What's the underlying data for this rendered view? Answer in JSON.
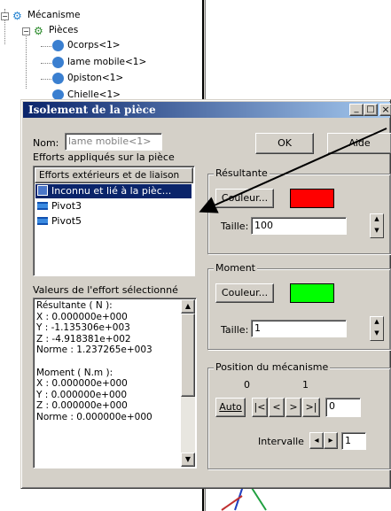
{
  "tree": {
    "root_label": "Mécanisme",
    "parts_label": "Pièces",
    "items": [
      "0corps<1>",
      "lame mobile<1>",
      "0piston<1>",
      "Chielle<1>"
    ]
  },
  "dialog": {
    "title": "Isolement de la pièce",
    "title_buttons": [
      "_",
      "□",
      "×"
    ],
    "name_label": "Nom:",
    "name_value": "lame mobile<1>",
    "ok_label": "OK",
    "help_label": "Aide",
    "efforts_section_label": "Efforts appliqués sur la pièce",
    "efforts_list_header": "Efforts extérieurs et de liaison",
    "efforts": [
      {
        "label": "Inconnu et lié à la pièc...",
        "selected": true
      },
      {
        "label": "Pivot3",
        "selected": false
      },
      {
        "label": "Pivot5",
        "selected": false
      }
    ],
    "values_section_label": "Valeurs de l'effort sélectionné",
    "values_lines": [
      "Résultante ( N ):",
      "X : 0.000000e+000",
      "Y : -1.135306e+003",
      "Z : -4.918381e+002",
      "Norme : 1.237265e+003",
      "",
      "Moment ( N.m ):",
      "X : 0.000000e+000",
      "Y : 0.000000e+000",
      "Z : 0.000000e+000",
      "Norme : 0.000000e+000"
    ],
    "resultante": {
      "group_label": "Résultante",
      "color_button": "Couleur...",
      "color": "#ff0000",
      "size_label": "Taille:",
      "size_value": "100"
    },
    "moment": {
      "group_label": "Moment",
      "color_button": "Couleur...",
      "color": "#00ff00",
      "size_label": "Taille:",
      "size_value": "1"
    },
    "position": {
      "group_label": "Position du mécanisme",
      "scale_start": "0",
      "scale_end": "1",
      "auto_label": "Auto",
      "nav_buttons": [
        "|<",
        "<",
        ">",
        ">|"
      ],
      "position_value": "0",
      "interval_label": "Intervalle",
      "interval_value": "1"
    }
  },
  "colors": {
    "dialog_bg": "#d4d0c8",
    "title_bar": "#0a246a",
    "selection": "#0a246a"
  }
}
